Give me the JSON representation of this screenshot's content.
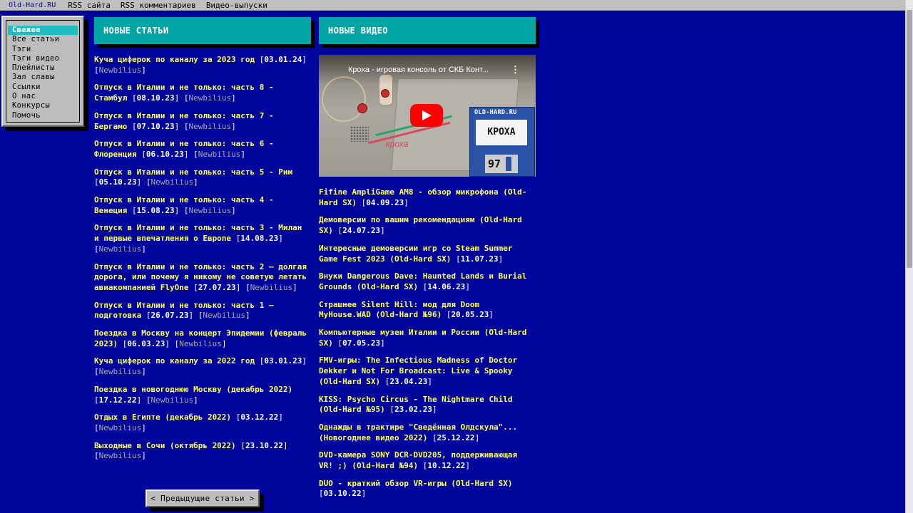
{
  "topbar": {
    "site_link": "Old-Hard.RU",
    "links": [
      "RSS сайта",
      "RSS комментариев",
      "Видео-выпуски"
    ]
  },
  "sidebar": {
    "items": [
      {
        "label": "Свежее",
        "active": true
      },
      {
        "label": "Все статьи"
      },
      {
        "label": "Тэги"
      },
      {
        "label": "Тэги видео"
      },
      {
        "label": "Плейлисты"
      },
      {
        "label": "Зал славы"
      },
      {
        "label": "Ссылки"
      },
      {
        "label": "О нас"
      },
      {
        "label": "Конкурсы"
      },
      {
        "label": "Помочь"
      }
    ]
  },
  "articles": {
    "header": "НОВЫЕ СТАТЬИ",
    "items": [
      {
        "title": "Куча циферок по каналу за 2023 год",
        "date": "03.01.24",
        "author": "Newbilius"
      },
      {
        "title": "Отпуск в Италии и не только: часть 8 - Стамбул",
        "date": "08.10.23",
        "author": "Newbilius"
      },
      {
        "title": "Отпуск в Италии и не только: часть 7 - Бергамо",
        "date": "07.10.23",
        "author": "Newbilius"
      },
      {
        "title": "Отпуск в Италии и не только: часть 6 - Флоренция",
        "date": "06.10.23",
        "author": "Newbilius"
      },
      {
        "title": "Отпуск в Италии и не только: часть 5 - Рим",
        "date": "05.10.23",
        "author": "Newbilius"
      },
      {
        "title": "Отпуск в Италии и не только: часть 4 - Венеция",
        "date": "15.08.23",
        "author": "Newbilius"
      },
      {
        "title": "Отпуск в Италии и не только: часть 3 - Милан и первые впечатления о Европе",
        "date": "14.08.23",
        "author": "Newbilius"
      },
      {
        "title": "Отпуск в Италии и не только: часть 2 — долгая дорога, или почему я никому не советую летать авиакомпанией FlyOne",
        "date": "27.07.23",
        "author": "Newbilius"
      },
      {
        "title": "Отпуск в Италии и не только: часть 1 — подготовка",
        "date": "26.07.23",
        "author": "Newbilius"
      },
      {
        "title": "Поездка в Москву на концерт Эпидемии (февраль 2023)",
        "date": "06.03.23",
        "author": "Newbilius"
      },
      {
        "title": "Куча циферок по каналу за 2022 год",
        "date": "03.01.23",
        "author": "Newbilius"
      },
      {
        "title": "Поездка в новогоднюю Москву (декабрь 2022)",
        "date": "17.12.22",
        "author": "Newbilius"
      },
      {
        "title": "Отдых в Египте (декабрь 2022)",
        "date": "03.12.22",
        "author": "Newbilius"
      },
      {
        "title": "Выходные в Сочи (октябрь 2022)",
        "date": "23.10.22",
        "author": "Newbilius"
      }
    ],
    "prev_button": "< Предыдущие статьи >"
  },
  "videos": {
    "header": "НОВЫЕ ВИДЕО",
    "player": {
      "title": "Кроха - игровая консоль от СКБ Конт...",
      "menu_icon": "vertical-dots-icon",
      "play_icon": "youtube-play-icon",
      "console_text": "кроха",
      "disk_label": "OLD-HARD.RU",
      "disk_sticker": "КРОХА",
      "disk_number": "97",
      "colors": {
        "play": "#ff0000",
        "disk": "#2a52a6"
      }
    },
    "items": [
      {
        "title": "Fifine AmpliGame AM8 - обзор микрофона (Old-Hard SX)",
        "date": "04.09.23"
      },
      {
        "title": "Демоверсии по вашим рекомендациям (Old-Hard SX)",
        "date": "24.07.23"
      },
      {
        "title": "Интересные демоверсии игр со Steam Summer Game Fest 2023 (Old-Hard SX)",
        "date": "11.07.23"
      },
      {
        "title": "Внуки Dangerous Dave: Haunted Lands и Burial Grounds (Old-Hard SX)",
        "date": "14.06.23"
      },
      {
        "title": "Страшнее Silent Hill: мод для Doom MyHouse.WAD (Old-Hard №96)",
        "date": "20.05.23"
      },
      {
        "title": "Компьютерные музеи Италии и России (Old-Hard SX)",
        "date": "07.05.23"
      },
      {
        "title": "FMV-игры: The Infectious Madness of Doctor Dekker и Not For Broadcast: Live & Spooky (Old-Hard SX)",
        "date": "23.04.23"
      },
      {
        "title": "KISS: Psycho Circus - The Nightmare Child (Old-Hard №95)",
        "date": "23.02.23"
      },
      {
        "title": "Однажды в трактире \"Сведённая Олдскула\"... (Новогоднее видео 2022)",
        "date": "25.12.22"
      },
      {
        "title": "DVD-камера SONY DCR-DVD205, поддерживающая VR! ;) (Old-Hard №94)",
        "date": "10.12.22"
      },
      {
        "title": "DUO - краткий обзор VR-игры (Old-Hard SX)",
        "date": "03.10.22"
      }
    ]
  },
  "colors": {
    "background": "#00069c",
    "header": "#00a6a6",
    "title": "#ffff54",
    "author": "#a8a8a8",
    "active_menu": "#1fbdc1"
  }
}
